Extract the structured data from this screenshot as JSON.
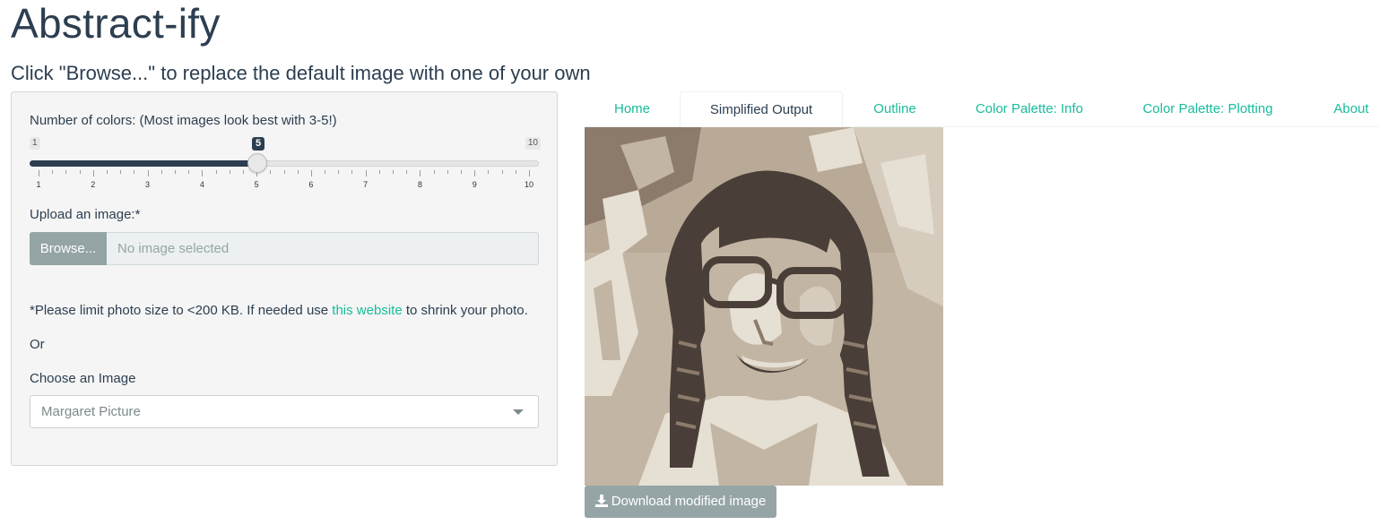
{
  "app": {
    "title": "Abstract-ify",
    "subtitle": "Click \"Browse...\" to replace the default image with one of your own"
  },
  "sidebar": {
    "num_colors_label": "Number of colors: (Most images look best with 3-5!)",
    "slider": {
      "min_label": "1",
      "max_label": "10",
      "value_label": "5",
      "value": 5,
      "min": 1,
      "max": 10,
      "tick_labels": [
        "1",
        "2",
        "3",
        "4",
        "5",
        "6",
        "7",
        "8",
        "9",
        "10"
      ]
    },
    "upload_label": "Upload an image:*",
    "browse_label": "Browse...",
    "file_placeholder": "No image selected",
    "note_before": "*Please limit photo size to <200 KB. If needed use ",
    "note_link": "this website",
    "note_after": " to shrink your photo.",
    "or_label": "Or",
    "choose_label": "Choose an Image",
    "choose_selected": "Margaret Picture"
  },
  "tabs": [
    {
      "label": "Home"
    },
    {
      "label": "Simplified Output",
      "active": true
    },
    {
      "label": "Outline"
    },
    {
      "label": "Color Palette: Info"
    },
    {
      "label": "Color Palette: Plotting"
    },
    {
      "label": "About"
    }
  ],
  "main": {
    "download_label": "Download modified image"
  },
  "colors": {
    "primary": "#2c3e50",
    "accent": "#18bc9c",
    "button_gray": "#95a5a6",
    "palette": [
      "#4a3f38",
      "#8c7b6b",
      "#c3b5a3",
      "#e6dfd3"
    ]
  },
  "icons": {
    "download": "download-icon",
    "dropdown": "caret-down-icon"
  }
}
